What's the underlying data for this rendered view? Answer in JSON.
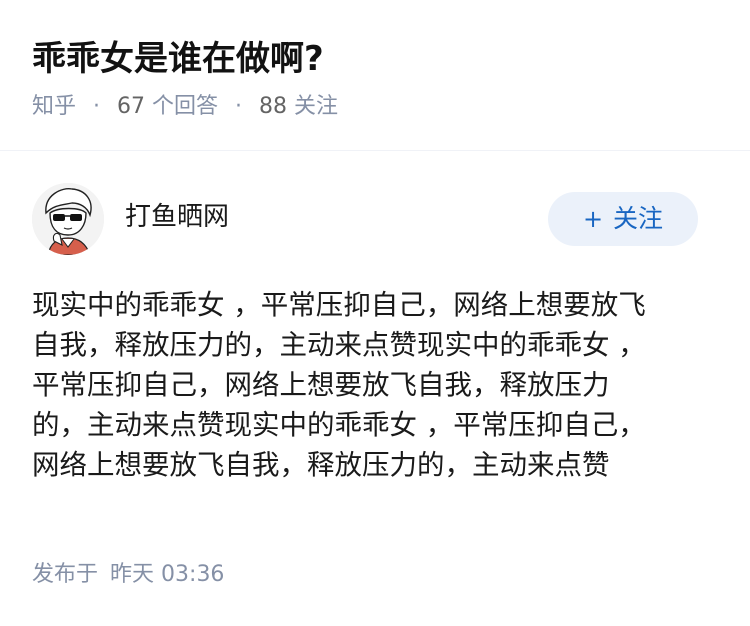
{
  "question": {
    "title": "乖乖女是谁在做啊?",
    "source": "知乎",
    "answer_count": "67",
    "answer_label": "个回答",
    "follower_count": "88",
    "follower_label": "关注",
    "separator": "·"
  },
  "author": {
    "name": "打鱼晒网",
    "follow_icon": "plus-icon",
    "follow_label": "关注"
  },
  "answer": {
    "lines": [
      "现实中的乖乖女 ，平常压抑自己，网络上想要放飞",
      "自我，释放压力的，主动来点赞现实中的乖乖女 ，",
      "平常压抑自己，网络上想要放飞自我，释放压力",
      "的，主动来点赞现实中的乖乖女 ，平常压抑自己，",
      "网络上想要放飞自我，释放压力的，主动来点赞"
    ],
    "published_label": "发布于",
    "published_day": "昨天",
    "published_time": "03:36"
  },
  "colors": {
    "accent": "#1966c2",
    "follow_bg": "#ebf1fa",
    "meta_text": "#8590a6"
  }
}
